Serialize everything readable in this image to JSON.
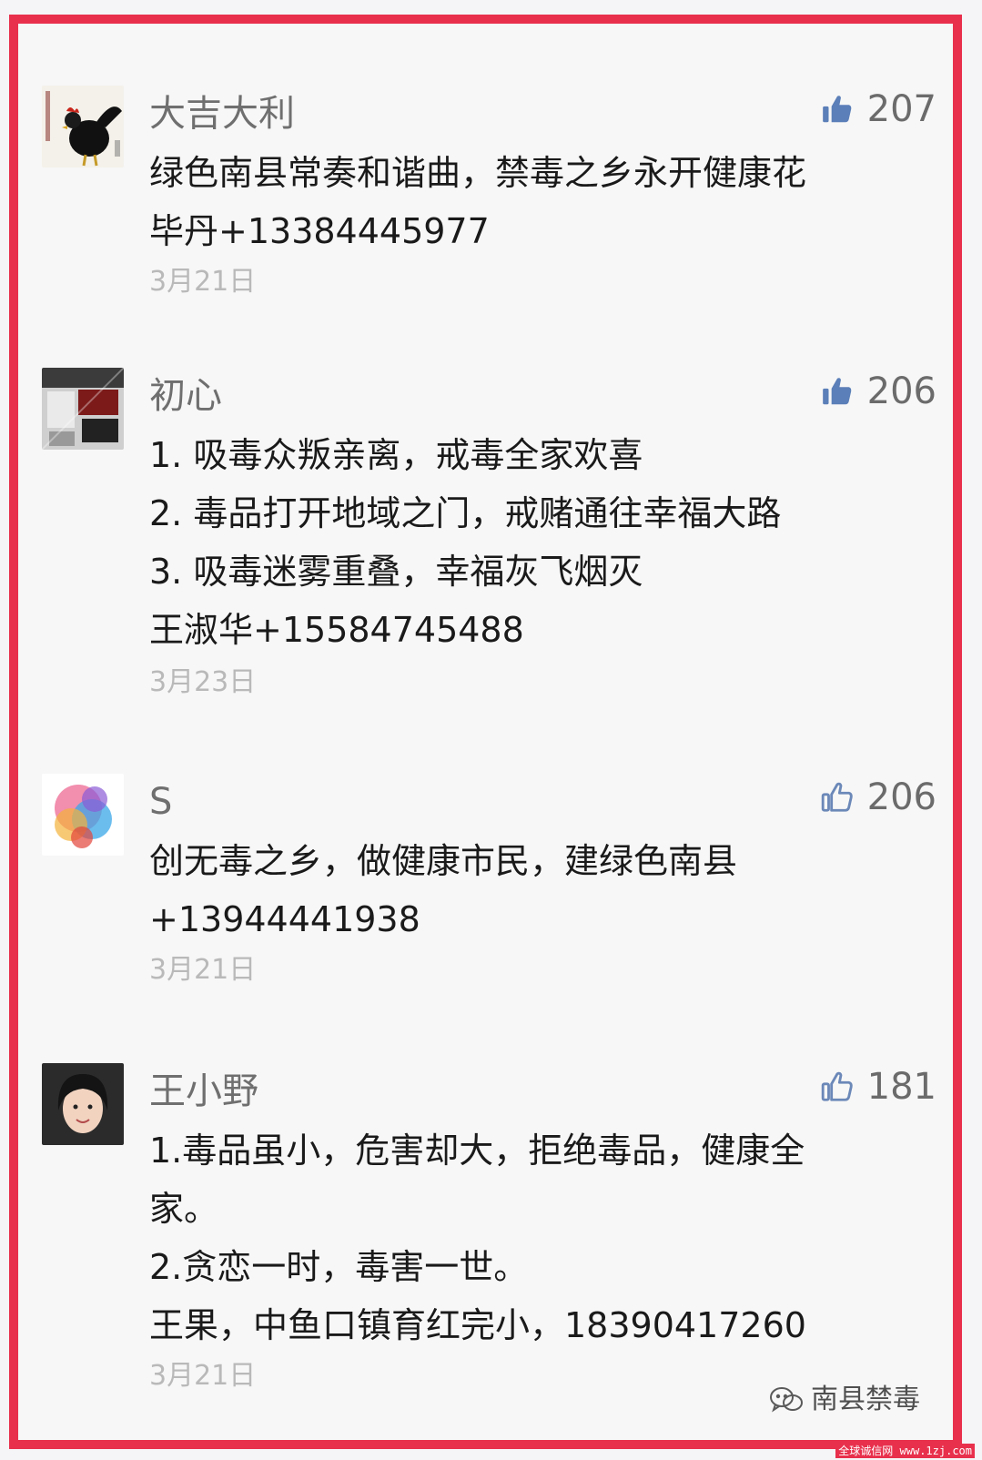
{
  "comments": [
    {
      "author": "大吉大利",
      "likes": "207",
      "lines": [
        "绿色南县常奏和谐曲，禁毒之乡永开健康花",
        "毕丹+13384445977"
      ],
      "date": "3月21日",
      "avatar_icon": "rooster-painting-avatar",
      "thumb_filled": true
    },
    {
      "author": "初心",
      "likes": "206",
      "lines": [
        "1. 吸毒众叛亲离，戒毒全家欢喜",
        "2. 毒品打开地域之门，戒赌通往幸福大路",
        "3. 吸毒迷雾重叠，幸福灰飞烟灭",
        "王淑华+15584745488"
      ],
      "date": "3月23日",
      "avatar_icon": "room-photo-avatar",
      "thumb_filled": true
    },
    {
      "author": "S",
      "likes": "206",
      "lines": [
        "创无毒之乡，做健康市民，建绿色南县",
        "+13944441938"
      ],
      "date": "3月21日",
      "avatar_icon": "colorful-art-avatar",
      "thumb_filled": false
    },
    {
      "author": "王小野",
      "likes": "181",
      "lines": [
        "1.毒品虽小，危害却大，拒绝毒品，健康全",
        "家。",
        "2.贪恋一时，毒害一世。",
        "王果，中鱼口镇育红完小，18390417260"
      ],
      "date": "3月21日",
      "avatar_icon": "portrait-photo-avatar",
      "thumb_filled": false
    }
  ],
  "watermark": {
    "label": "南县禁毒",
    "icon": "wechat-icon",
    "site": "全球诚信网 www.1zj.com"
  },
  "colors": {
    "frame": "#e8304c",
    "thumb_filled": "#5b7fb8",
    "thumb_outline": "#6b88b8"
  }
}
